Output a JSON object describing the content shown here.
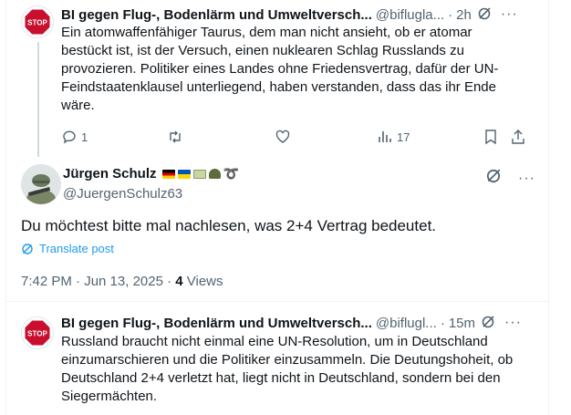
{
  "post1": {
    "name": "BI gegen Flug-, Bodenlärm und Umweltversch...",
    "handle": "@biflugla...",
    "time": "2h",
    "text": "Ein atomwaffenfähiger Taurus, dem man nicht ansieht, ob er atomar\nbestückt ist, ist der Versuch, einen nuklearen Schlag Russlands zu\nprovozieren. Politiker eines Landes ohne Friedensvertrag, dafür der UN-\nFeindstaatenklausel unterliegend, haben verstanden, dass das ihr Ende\nwäre.",
    "replies": "1",
    "views": "17",
    "avatar_text": "STOP"
  },
  "main": {
    "name": "Jürgen Schulz",
    "handle": "@JuergenSchulz63",
    "text": "Du möchtest bitte mal nachlesen, was 2+4 Vertrag bedeutet.",
    "translate": "Translate post",
    "time": "7:42 PM · Jun 13, 2025 · ",
    "views_count": "4",
    "views_label": " Views"
  },
  "post2": {
    "name": "BI gegen Flug-, Bodenlärm und Umweltversch...",
    "handle": "@biflugl...",
    "time": "15m",
    "text": "Russland braucht nicht einmal eine UN-Resolution, um in Deutschland\neinzumarschieren und die Politiker einzusammeln. Die Deutungshoheit, ob\nDeutschland 2+4 verletzt hat, liegt nicht in Deutschland, sondern bei den\nSiegermächten.",
    "avatar_text": "STOP"
  },
  "colors": {
    "link": "#1d9bf0",
    "muted": "#536471",
    "stop_red": "#c8102e"
  },
  "icons": [
    "grok-icon",
    "more-icon",
    "reply-icon",
    "retweet-icon",
    "like-icon",
    "views-icon",
    "bookmark-icon",
    "share-icon",
    "translate-icon"
  ]
}
